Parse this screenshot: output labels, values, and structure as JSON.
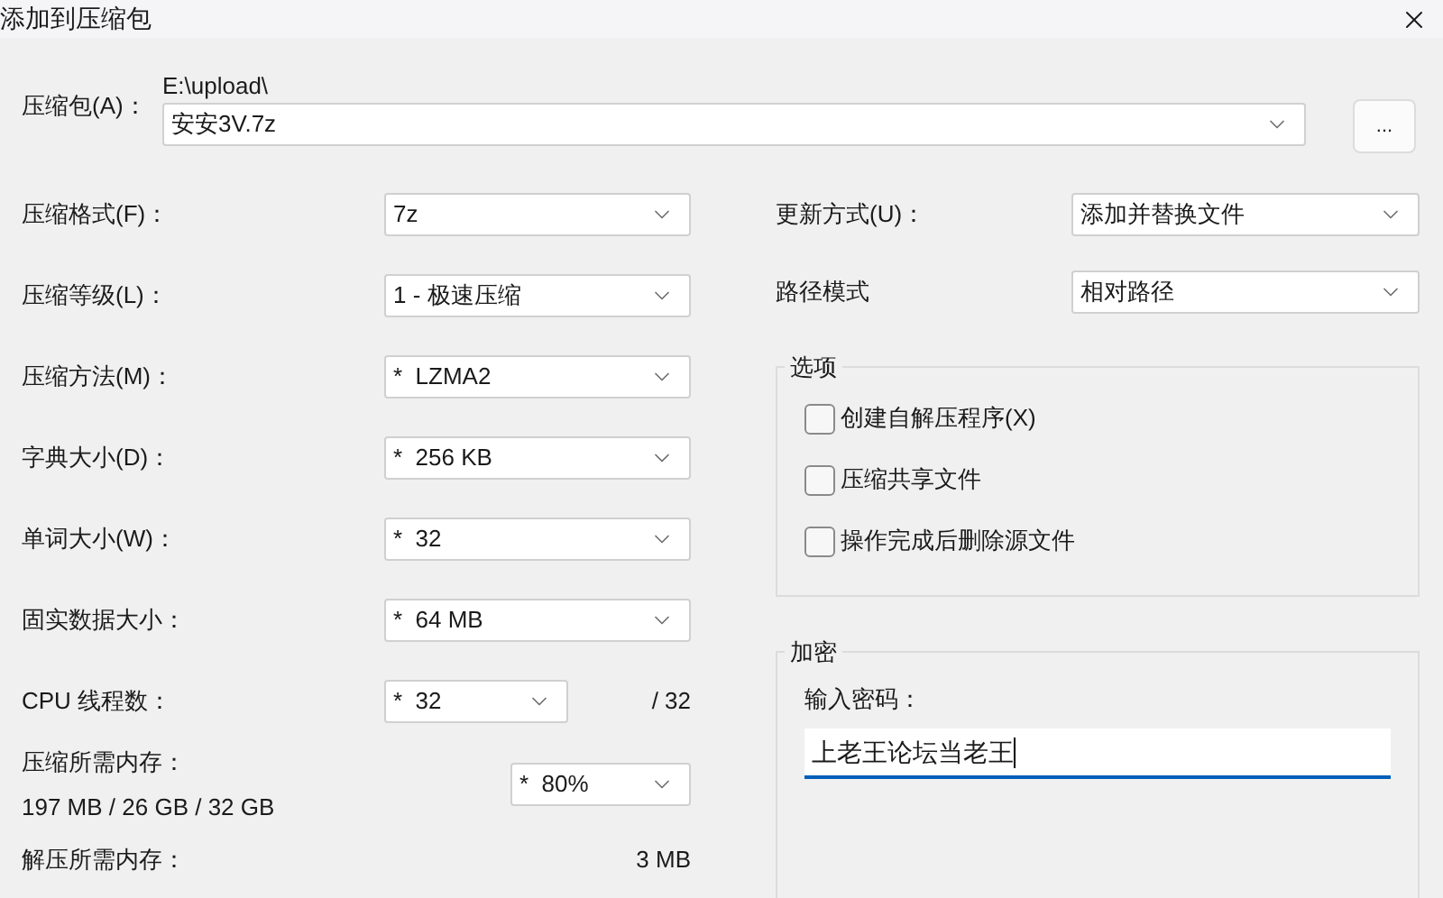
{
  "window": {
    "title": "添加到压缩包"
  },
  "archive": {
    "label": "压缩包(A)：",
    "path": "E:\\upload\\",
    "value": "安安3V.7z",
    "browse_button": "..."
  },
  "left_fields": [
    {
      "kind": "select",
      "label": "压缩格式(F)：",
      "value": "7z"
    },
    {
      "kind": "select",
      "label": "压缩等级(L)：",
      "value": "1 - 极速压缩"
    },
    {
      "kind": "select",
      "label": "压缩方法(M)：",
      "value": "*  LZMA2"
    },
    {
      "kind": "select",
      "label": "字典大小(D)：",
      "value": "*  256 KB"
    },
    {
      "kind": "select",
      "label": "单词大小(W)：",
      "value": "*  32"
    },
    {
      "kind": "select",
      "label": "固实数据大小：",
      "value": "*  64 MB"
    },
    {
      "kind": "cpu",
      "label": "CPU 线程数：",
      "value": "*  32",
      "suffix": "/ 32"
    },
    {
      "kind": "memory",
      "label": "压缩所需内存：",
      "detail": "197 MB / 26 GB / 32 GB",
      "value": "*  80%"
    },
    {
      "kind": "info",
      "label": "解压所需内存：",
      "value": "3 MB"
    }
  ],
  "right_fields": [
    {
      "label": "更新方式(U)：",
      "value": "添加并替换文件"
    },
    {
      "label": "路径模式",
      "value": "相对路径"
    }
  ],
  "options": {
    "title": "选项",
    "items": [
      {
        "label": "创建自解压程序(X)",
        "checked": false
      },
      {
        "label": "压缩共享文件",
        "checked": false
      },
      {
        "label": "操作完成后删除源文件",
        "checked": false
      }
    ]
  },
  "encryption": {
    "title": "加密",
    "password_label": "输入密码：",
    "password": "上老王论坛当老王",
    "focused": true
  }
}
